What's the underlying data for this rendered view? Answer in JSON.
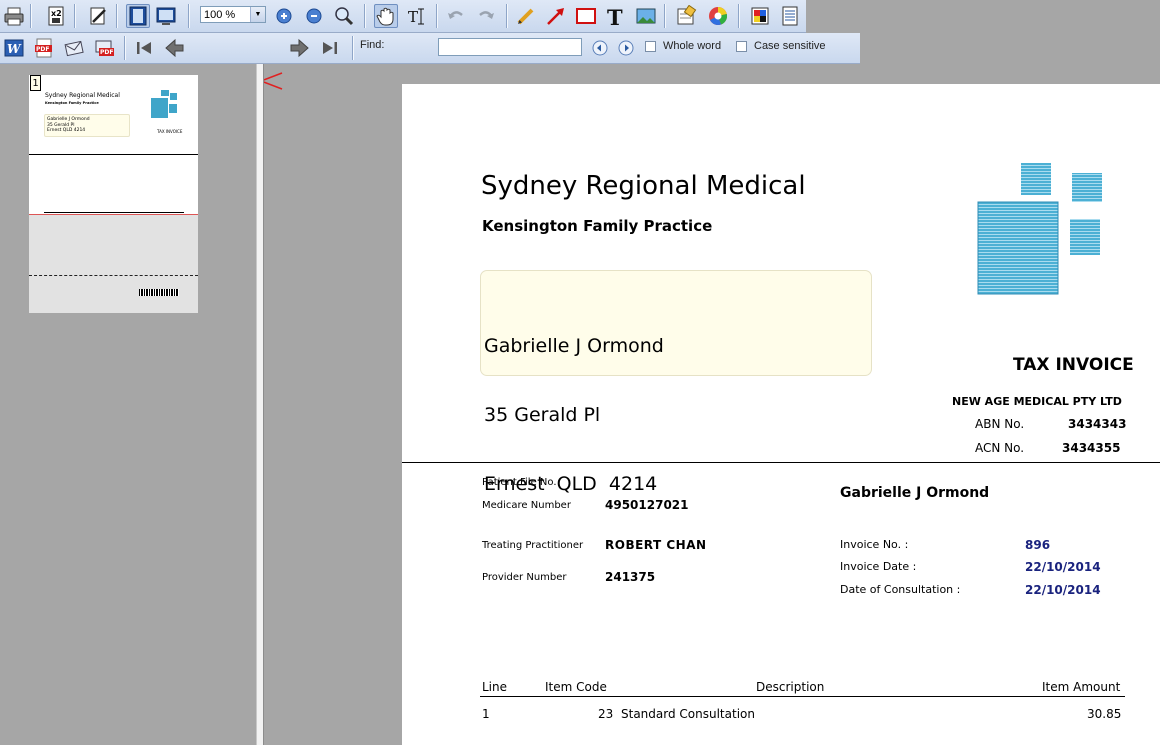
{
  "toolbar": {
    "zoom": "100 %",
    "page_number": "1",
    "find_label": "Find:",
    "find_value": "",
    "whole_word_label": "Whole word",
    "case_sensitive_label": "Case sensitive"
  },
  "thumbnail": {
    "page_label": "1"
  },
  "invoice": {
    "clinic_name": "Sydney Regional Medical",
    "practice_name": "Kensington Family Practice",
    "address": [
      "Gabrielle J Ormond",
      "35 Gerald Pl",
      "Ernest  QLD  4214"
    ],
    "tax_invoice": "TAX INVOICE",
    "company": "NEW AGE MEDICAL PTY LTD",
    "abn_label": "ABN No.",
    "abn_value": "3434343",
    "acn_label": "ACN No.",
    "acn_value": "3434355",
    "patient_file_label": "Patient File No.",
    "medicare_label": "Medicare Number",
    "medicare_value": "4950127021",
    "practitioner_label": "Treating Practitioner",
    "practitioner_value": "ROBERT CHAN",
    "provider_label": "Provider Number",
    "provider_value": "241375",
    "patient_name": "Gabrielle J Ormond",
    "invoice_no_label": "Invoice No. :",
    "invoice_no_value": "896",
    "invoice_date_label": "Invoice Date :",
    "invoice_date_value": "22/10/2014",
    "consultation_label": "Date of Consultation :",
    "consultation_value": "22/10/2014",
    "table": {
      "headers": [
        "Line",
        "Item Code",
        "Description",
        "Item Amount"
      ],
      "rows": [
        {
          "line": "1",
          "code": "23",
          "description": "Standard Consultation",
          "amount": "30.85"
        }
      ]
    }
  },
  "colors": {
    "logo_blue": "#3fa5c9",
    "highlight_box": "#fffdea",
    "value_blue": "#1a237e"
  }
}
